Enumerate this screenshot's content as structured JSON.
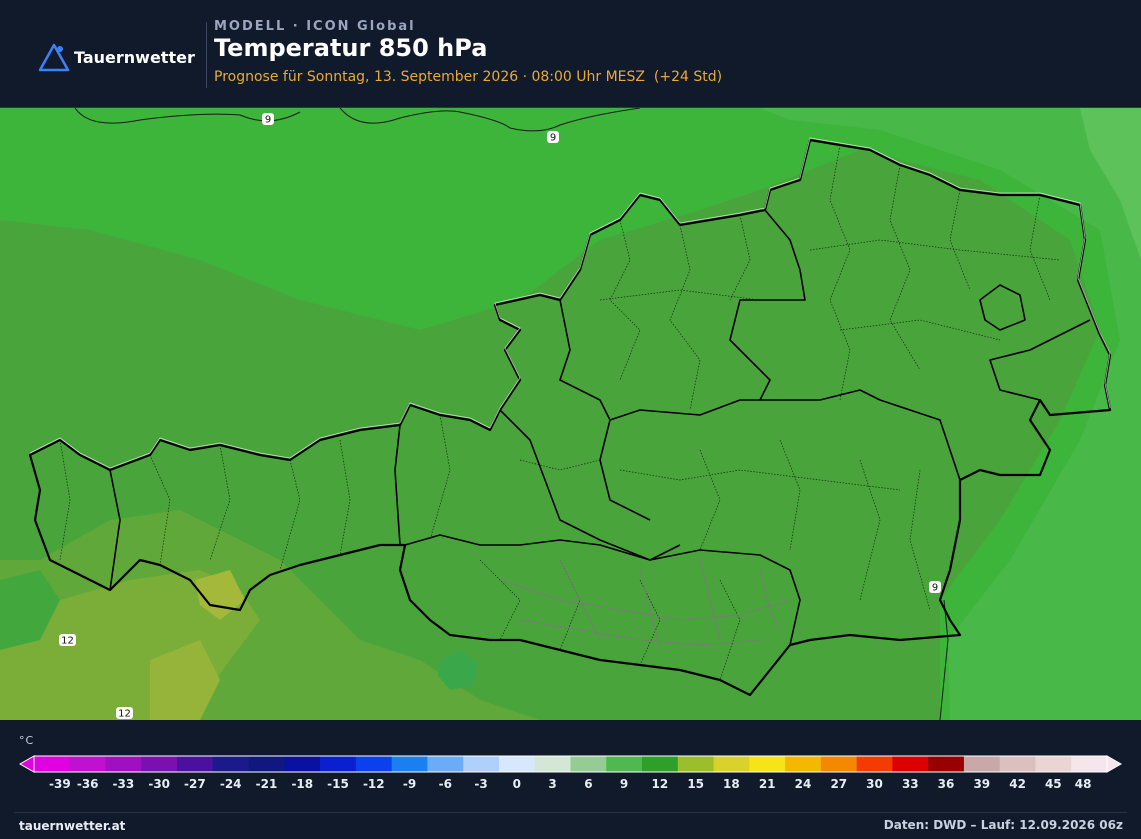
{
  "header": {
    "brand": "Tauernwetter",
    "model_label": "MODELL · ICON Global",
    "title": "Temperatur 850 hPa",
    "subtitle": "Prognose für Sonntag, 13. September 2026 · 08:00 Uhr MESZ  (+24 Std)"
  },
  "map": {
    "contour_labels": [
      "9",
      "9",
      "9",
      "12",
      "12"
    ]
  },
  "legend": {
    "unit": "°C",
    "ticks": [
      "-39",
      "-36",
      "-33",
      "-30",
      "-27",
      "-24",
      "-21",
      "-18",
      "-15",
      "-12",
      "-9",
      "-6",
      "-3",
      "0",
      "3",
      "6",
      "9",
      "12",
      "15",
      "18",
      "21",
      "24",
      "27",
      "30",
      "33",
      "36",
      "39",
      "42",
      "45",
      "48"
    ],
    "colors": [
      "#e000e0",
      "#c010d0",
      "#a010c0",
      "#7a10b0",
      "#4a10a0",
      "#1a1a8a",
      "#101880",
      "#0a10a0",
      "#0a20d0",
      "#0a40ee",
      "#1a80f0",
      "#6aacf8",
      "#aed0fa",
      "#d8e8fc",
      "#d4e6d4",
      "#94cc94",
      "#50b850",
      "#2ea02a",
      "#9cbe2a",
      "#d8d22a",
      "#f6e418",
      "#f4b800",
      "#f48800",
      "#f43c00",
      "#dc0000",
      "#980000",
      "#c8a8a8",
      "#dcc0c0",
      "#ead4d4",
      "#f4e6ea"
    ]
  },
  "footer": {
    "left": "tauernwetter.at",
    "right": "Daten: DWD – Lauf: 12.09.2026 06z"
  }
}
